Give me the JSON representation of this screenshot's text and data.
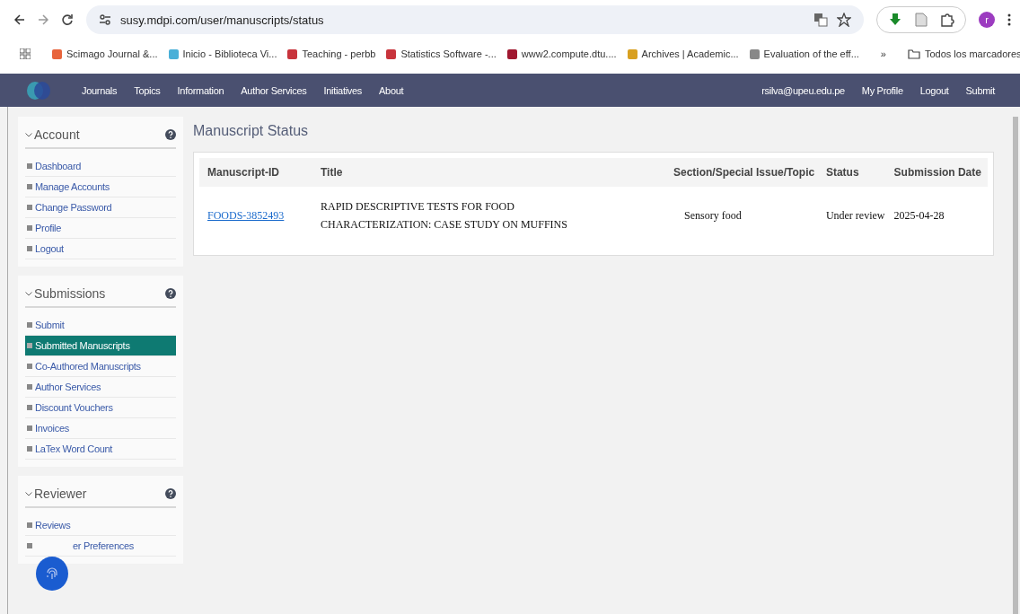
{
  "browser": {
    "url": "susy.mdpi.com/user/manuscripts/status",
    "avatar": "r",
    "bookmarks": [
      {
        "label": "Scimago Journal &...",
        "color": "#e8643c"
      },
      {
        "label": "Inicio - Biblioteca Vi...",
        "color": "#4ab0d8"
      },
      {
        "label": "Teaching - perbb",
        "color": "#c8343c"
      },
      {
        "label": "Statistics Software -...",
        "color": "#c8343c"
      },
      {
        "label": "www2.compute.dtu....",
        "color": "#a01830"
      },
      {
        "label": "Archives | Academic...",
        "color": "#d8a020"
      },
      {
        "label": "Evaluation of the eff...",
        "color": "#888888"
      }
    ],
    "more": "»",
    "folder": "Todos los marcadores"
  },
  "nav": {
    "left": [
      "Journals",
      "Topics",
      "Information",
      "Author Services",
      "Initiatives",
      "About"
    ],
    "right": [
      "rsilva@upeu.edu.pe",
      "My Profile",
      "Logout",
      "Submit"
    ]
  },
  "sidebar": [
    {
      "title": "Account",
      "items": [
        {
          "label": "Dashboard",
          "selected": false
        },
        {
          "label": "Manage Accounts",
          "selected": false
        },
        {
          "label": "Change Password",
          "selected": false
        },
        {
          "label": "Profile",
          "selected": false
        },
        {
          "label": "Logout",
          "selected": false
        }
      ]
    },
    {
      "title": "Submissions",
      "items": [
        {
          "label": "Submit",
          "selected": false
        },
        {
          "label": "Submitted Manuscripts",
          "selected": true
        },
        {
          "label": "Co-Authored Manuscripts",
          "selected": false
        },
        {
          "label": "Author Services",
          "selected": false
        },
        {
          "label": "Discount Vouchers",
          "selected": false
        },
        {
          "label": "Invoices",
          "selected": false
        },
        {
          "label": "LaTex Word Count",
          "selected": false
        }
      ]
    },
    {
      "title": "Reviewer",
      "items": [
        {
          "label": "Reviews",
          "selected": false
        },
        {
          "label": "er Preferences",
          "selected": false,
          "covered": true
        }
      ]
    }
  ],
  "page_title": "Manuscript Status",
  "table": {
    "columns": [
      "Manuscript-ID",
      "Title",
      "Section/Special Issue/Topic",
      "Status",
      "Submission Date"
    ],
    "rows": [
      {
        "id": "FOODS-3852493",
        "title": "RAPID DESCRIPTIVE TESTS FOR FOOD CHARACTERIZATION: CASE STUDY ON MUFFINS",
        "section": "Sensory food",
        "status": "Under review",
        "date": "2025-04-28"
      }
    ]
  }
}
